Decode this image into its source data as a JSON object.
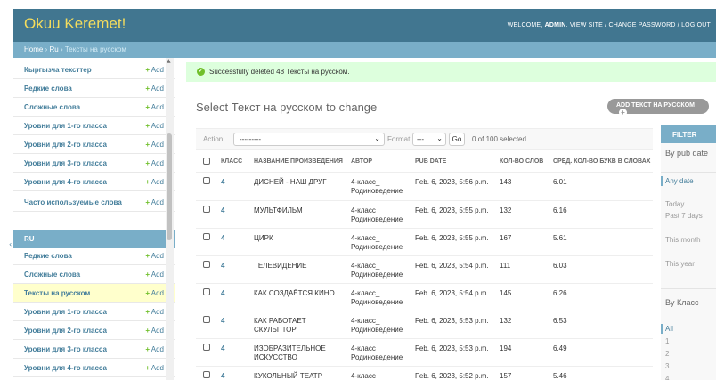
{
  "header": {
    "brand": "Okuu Keremet!",
    "welcome": "WELCOME,",
    "user": "ADMIN",
    "links": ". VIEW SITE / CHANGE PASSWORD / LOG OUT"
  },
  "breadcrumbs": {
    "home": "Home",
    "sep1": "›",
    "app": "Ru",
    "sep2": "›",
    "current": "Тексты на русском"
  },
  "sidebar": {
    "add_label": "Add",
    "add_icon": "+",
    "group1_items": [
      "Кыргызча тексттер",
      "Редкие слова",
      "Сложные слова",
      "Уровни для 1-го класса",
      "Уровни для 2-го класса",
      "Уровни для 3-го класса",
      "Уровни для 4-го класса",
      "Часто используемые слова"
    ],
    "group2_title": "RU",
    "group2_items": [
      "Редкие слова",
      "Сложные слова",
      "Тексты на русском",
      "Уровни для 1-го класса",
      "Уровни для 2-го класса",
      "Уровни для 3-го класса",
      "Уровни для 4-го класса"
    ],
    "current_item": "Тексты на русском"
  },
  "message": {
    "text": "Successfully deleted 48 Тексты на русском.",
    "icon": "check-circle-icon"
  },
  "page": {
    "title": "Select Текст на русском to change",
    "add_button": "ADD ТЕКСТ НА РУССКОМ",
    "add_icon": "+"
  },
  "actions": {
    "label": "Action:",
    "selected_value": "---------",
    "format_label": "Format",
    "format_value": "---",
    "go_label": "Go",
    "selected_count": "0 of 100 selected",
    "chevron": "⌄"
  },
  "table": {
    "columns": [
      "КЛАСС",
      "НАЗВАНИЕ ПРОИЗВЕДЕНИЯ",
      "АВТОР",
      "PUB DATE",
      "КОЛ-ВО СЛОВ",
      "СРЕД. КОЛ-ВО БУКВ В СЛОВАХ"
    ],
    "rows": [
      {
        "klass": "4",
        "title": "ДИСНЕЙ - НАШ ДРУГ",
        "author": "4-класс_ Родиноведение",
        "date": "Feb. 6, 2023, 5:56 p.m.",
        "words": "143",
        "avg": "6.01"
      },
      {
        "klass": "4",
        "title": "МУЛЬТФИЛЬМ",
        "author": "4-класс_ Родиноведение",
        "date": "Feb. 6, 2023, 5:55 p.m.",
        "words": "132",
        "avg": "6.16"
      },
      {
        "klass": "4",
        "title": "ЦИРК",
        "author": "4-класс_ Родиноведение",
        "date": "Feb. 6, 2023, 5:55 p.m.",
        "words": "167",
        "avg": "5.61"
      },
      {
        "klass": "4",
        "title": "ТЕЛЕВИДЕНИЕ",
        "author": "4-класс_ Родиноведение",
        "date": "Feb. 6, 2023, 5:54 p.m.",
        "words": "111",
        "avg": "6.03"
      },
      {
        "klass": "4",
        "title": "КАК СОЗДАЁТСЯ КИНО",
        "author": "4-класс_ Родиноведение",
        "date": "Feb. 6, 2023, 5:54 p.m.",
        "words": "145",
        "avg": "6.26"
      },
      {
        "klass": "4",
        "title": "КАК РАБОТАЕТ СКУЛЬПТОР",
        "author": "4-класс_ Родиноведение",
        "date": "Feb. 6, 2023, 5:53 p.m.",
        "words": "132",
        "avg": "6.53"
      },
      {
        "klass": "4",
        "title": "ИЗОБРАЗИТЕЛЬНОЕ ИСКУССТВО",
        "author": "4-класс_ Родиноведение",
        "date": "Feb. 6, 2023, 5:53 p.m.",
        "words": "194",
        "avg": "6.49"
      },
      {
        "klass": "4",
        "title": "КУКОЛЬНЫЙ ТЕАТР",
        "author": "4-класс",
        "date": "Feb. 6, 2023, 5:52 p.m.",
        "words": "157",
        "avg": "5.46"
      }
    ]
  },
  "filter": {
    "title": "FILTER",
    "pubdate_heading": "By pub date",
    "pubdate_items": [
      "Any date",
      "Today",
      "Past 7 days",
      "This month",
      "This year"
    ],
    "klass_heading": "By Класс",
    "klass_items": [
      "All",
      "1",
      "2",
      "3",
      "4"
    ]
  }
}
